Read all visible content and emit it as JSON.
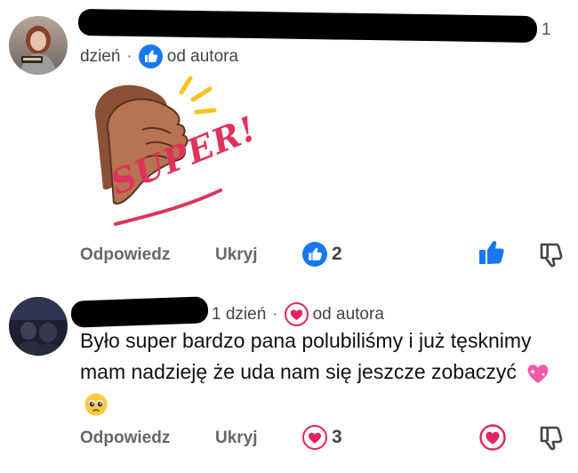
{
  "comment1": {
    "reply_count": "1",
    "time": "dzień",
    "badge_label": "od autora",
    "sticker_text": "SUPER!",
    "actions": {
      "reply": "Odpowiedz",
      "hide": "Ukryj"
    },
    "reaction_count": "2",
    "reaction_type": "like-icon"
  },
  "comment2": {
    "time": "1 dzień",
    "badge_label": "od autora",
    "text": "Było super bardzo pana polubiliśmy i już tęsknimy mam nadzieję że uda nam się jeszcze zobaczyć",
    "emojis": [
      "sparkling-heart-emoji",
      "pleading-face-emoji"
    ],
    "actions": {
      "reply": "Odpowiedz",
      "hide": "Ukryj"
    },
    "reaction_count": "3",
    "reaction_type": "heart-icon"
  },
  "colors": {
    "like_blue": "#1877f2",
    "heart_red": "#e0245e",
    "muted_text": "#65676b"
  }
}
